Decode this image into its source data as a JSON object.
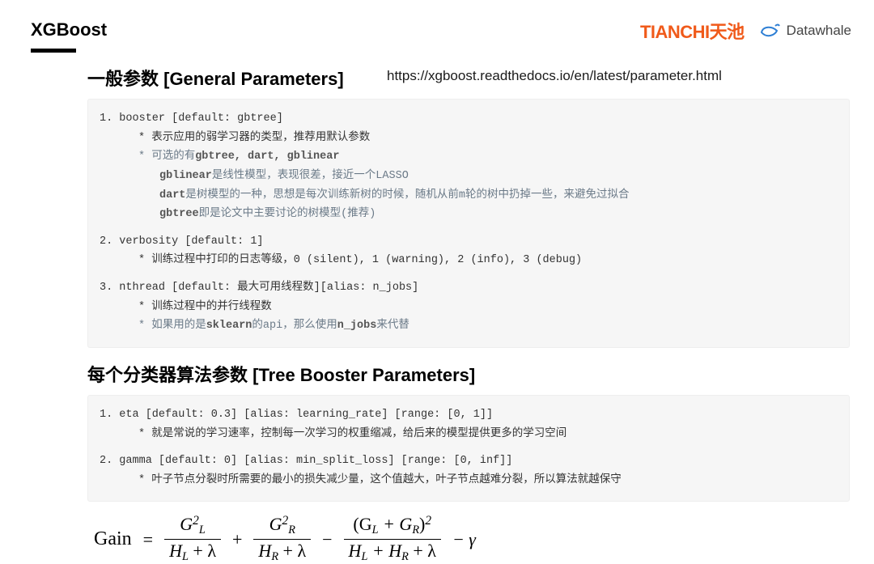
{
  "header": {
    "title": "XGBoost"
  },
  "logos": {
    "tianchi": "TIANCHI",
    "tianchi_cn": "天池",
    "datawhale": "Datawhale"
  },
  "url": "https://xgboost.readthedocs.io/en/latest/parameter.html",
  "s1": {
    "heading": "一般参数 [General Parameters]",
    "l1": "1. booster [default: gbtree]",
    "l1a": "* 表示应用的弱学习器的类型，推荐用默认参数",
    "l1b_pre": "* 可选的有",
    "l1b_code": "gbtree, dart, gblinear",
    "l1c_code": "gblinear",
    "l1c_txt": "是线性模型，表现很差，接近一个LASSO",
    "l1d_code": "dart",
    "l1d_txt": "是树模型的一种，思想是每次训练新树的时候，随机从前m轮的树中扔掉一些，来避免过拟合",
    "l1e_code": "gbtree",
    "l1e_txt": "即是论文中主要讨论的树模型(推荐)",
    "l2": "2. verbosity [default: 1]",
    "l2a": "* 训练过程中打印的日志等级，0 (silent), 1 (warning), 2 (info), 3 (debug)",
    "l3": "3. nthread [default: 最大可用线程数][alias: n_jobs]",
    "l3a": "* 训练过程中的并行线程数",
    "l3b_pre": "* 如果用的是",
    "l3b_code1": "sklearn",
    "l3b_mid": "的api，那么使用",
    "l3b_code2": "n_jobs",
    "l3b_end": "来代替"
  },
  "s2": {
    "heading": "每个分类器算法参数 [Tree  Booster Parameters]",
    "l1": "1. eta [default: 0.3] [alias: learning_rate] [range: [0, 1]]",
    "l1a": "* 就是常说的学习速率，控制每一次学习的权重缩减，给后来的模型提供更多的学习空间",
    "l2": "2. gamma [default: 0] [alias: min_split_loss] [range: [0, inf]]",
    "l2a": "* 叶子节点分裂时所需要的最小的损失减少量，这个值越大，叶子节点越难分裂，所以算法就越保守"
  },
  "formula": {
    "label": "Gain",
    "eq": "=",
    "n1a": "G",
    "n1b": "L",
    "n1c": "2",
    "d1a": "H",
    "d1b": "L",
    "d1c": "+ λ",
    "plus": "+",
    "n2a": "G",
    "n2b": "R",
    "n2c": "2",
    "d2a": "H",
    "d2b": "R",
    "d2c": "+ λ",
    "minus": "−",
    "n3a": "(G",
    "n3b": "L",
    "n3c": " + G",
    "n3d": "R",
    "n3e": ")",
    "n3f": "2",
    "d3a": "H",
    "d3b": "L",
    "d3c": " + H",
    "d3d": "R",
    "d3e": " + λ",
    "tail": "− γ"
  }
}
